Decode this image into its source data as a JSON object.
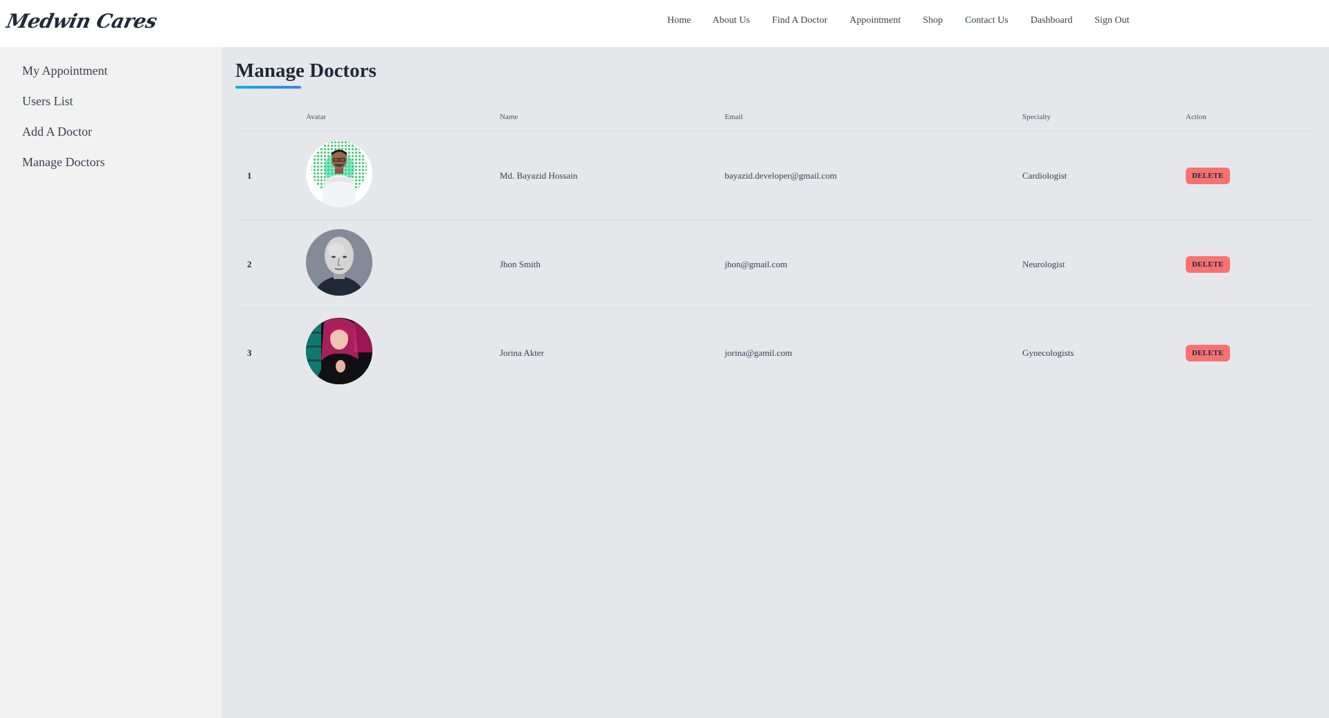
{
  "brand": {
    "logo_text": "Medwin Cares"
  },
  "nav": {
    "items": [
      {
        "label": "Home"
      },
      {
        "label": "About Us"
      },
      {
        "label": "Find A Doctor"
      },
      {
        "label": "Appointment"
      },
      {
        "label": "Shop"
      },
      {
        "label": "Contact Us"
      },
      {
        "label": "Dashboard"
      },
      {
        "label": "Sign Out"
      }
    ]
  },
  "sidebar": {
    "items": [
      {
        "label": "My Appointment"
      },
      {
        "label": "Users List"
      },
      {
        "label": "Add A Doctor"
      },
      {
        "label": "Manage Doctors"
      }
    ]
  },
  "main": {
    "title": "Manage Doctors",
    "table": {
      "headers": {
        "avatar": "Avatar",
        "name": "Name",
        "email": "Email",
        "specialty": "Specialty",
        "action": "Action"
      },
      "rows": [
        {
          "num": "1",
          "name": "Md. Bayazid Hossain",
          "email": "bayazid.developer@gmail.com",
          "specialty": "Cardiologist",
          "action": "DELETE",
          "avatar": "man-with-glasses-avatar"
        },
        {
          "num": "2",
          "name": "Jhon Smith",
          "email": "jhon@gmail.com",
          "specialty": "Neurologist",
          "action": "DELETE",
          "avatar": "bald-man-avatar"
        },
        {
          "num": "3",
          "name": "Jorina Akter",
          "email": "jorina@gamil.com",
          "specialty": "Gynecologists",
          "action": "DELETE",
          "avatar": "woman-avatar"
        }
      ]
    }
  },
  "colors": {
    "delete": "#f87171",
    "accent_start": "#06b6d4",
    "accent_end": "#3b82f6",
    "sidebar_bg": "#f2f2f2",
    "main_bg": "#e5e7eb"
  }
}
